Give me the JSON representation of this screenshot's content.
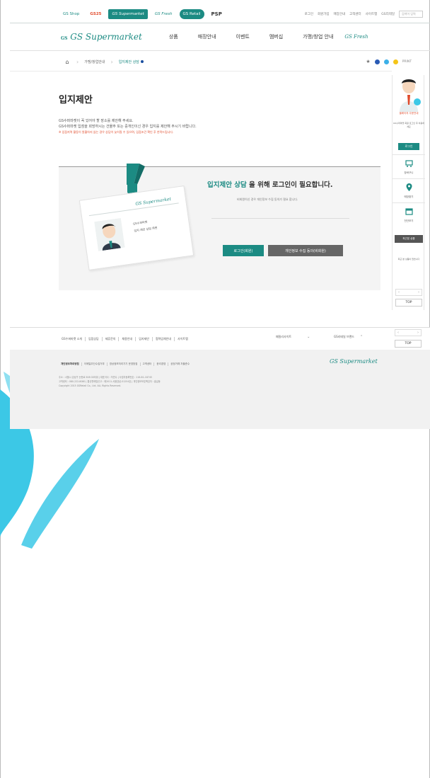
{
  "topbar": {
    "brands": [
      "GS Shop",
      "GS25",
      "GS Supermarket",
      "GS Fresh",
      "GS Retail",
      "PSP"
    ],
    "util_links": [
      "로그인",
      "회원가입",
      "매장안내",
      "고객센터",
      "사이트맵",
      "GS리테일"
    ],
    "search_placeholder": "검색어 입력"
  },
  "header": {
    "logo_text": "GS Supermarket",
    "logo_small": "GS",
    "nav": [
      "상품",
      "매장안내",
      "이벤트",
      "멤버십",
      "가맹/창업 안내"
    ],
    "nav_logo": "GS Fresh"
  },
  "breadcrumb": {
    "items": [
      "가맹/창업안내",
      "입지제안 상담"
    ],
    "print_label": "PRINT"
  },
  "page": {
    "title": "입지제안",
    "intro": [
      "GS수퍼마켓이 꼭 있어야 할 장소를 제안해 주세요.",
      "GS수퍼마켓 입점을 희망하시는 건물주 또는 중개인이신 경우 입지를 제안해 주시기 바랍니다.",
      "※ 입점지역 활동이 원활하지 않는 경우 상담이 늦어질 수 있으며, 입점조건 확인 후 연락드립니다."
    ]
  },
  "login_box": {
    "heading_highlight": "입지제안 상담",
    "heading_rest": " 을 위해 로그인이 필요합니다.",
    "sub": "비회원이신 경우 개인정보 수집 동의가 필요 합니다.",
    "card_logo": "GS Supermarket",
    "card_lines": [
      "GS수퍼마켓",
      "입지 제안 상담 회원"
    ],
    "login_button": "로그인(회원)",
    "nonmember_button": "개인정보 수집 동의(비회원)"
  },
  "quick_menu": {
    "caption": "올레이지 주문안내",
    "note": "GS수퍼마켓 회원 로그인 후 이용하세요",
    "login": "로그인",
    "items": [
      "장바구니",
      "매장찾기",
      "전단보기"
    ],
    "dark_label": "최근본 상품",
    "recent_note": "최근 본 상품이 없습니다",
    "top_label": "TOP"
  },
  "footer": {
    "links": [
      "GS수퍼마켓 소개",
      "입점상담",
      "제휴문의",
      "채용안내",
      "입지제안",
      "협력업체안내",
      "사이트맵"
    ],
    "select_family": "패밀리사이트",
    "select_brand": "GS리테일 브랜드",
    "links2": [
      "개인정보처리방침",
      "이메일무단수집거부",
      "영상정보처리기기 운영방침",
      "고객센터",
      "윤리경영",
      "공정거래 자율준수"
    ],
    "info": [
      "주소 : 서울시 강남구 논현로 508 GS타워 | 대표이사 : 허연수 | 사업자등록번호 : 116-81-18745",
      "고객센터 : 080-222-8080 | 통신판매업신고 : 제2011-서울강남-01254호 | 개인정보보호책임자 : 홍길동",
      "Copyright 2015 GSRetail Co., Ltd. ALL Rights Reserved."
    ],
    "logo": "GS Supermarket"
  },
  "colors": {
    "brand_teal": "#1c8b83",
    "accent_red": "#e04a2a",
    "footer_bg": "#f1f1f1",
    "swirl": "#3cc8e6"
  }
}
